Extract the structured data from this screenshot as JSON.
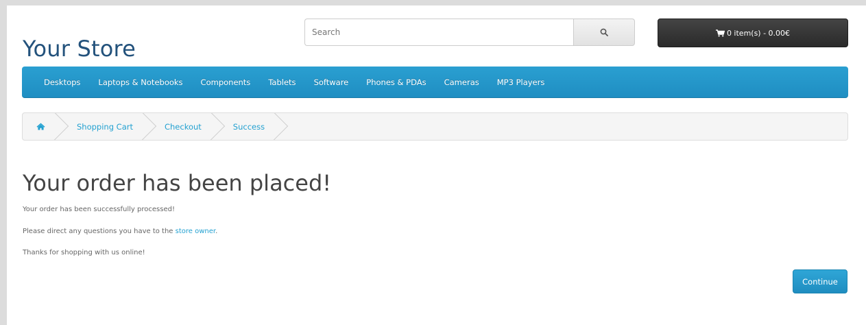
{
  "header": {
    "logo_text": "Your Store",
    "search_placeholder": "Search",
    "cart_label": "0 item(s) - 0.00€"
  },
  "nav": {
    "items": [
      "Desktops",
      "Laptops & Notebooks",
      "Components",
      "Tablets",
      "Software",
      "Phones & PDAs",
      "Cameras",
      "MP3 Players"
    ]
  },
  "breadcrumb": {
    "home_icon": "home-icon",
    "items": [
      "Shopping Cart",
      "Checkout",
      "Success"
    ]
  },
  "content": {
    "title": "Your order has been placed!",
    "line1": "Your order has been successfully processed!",
    "line2_prefix": "Please direct any questions you have to the ",
    "line2_link": "store owner",
    "line2_suffix": ".",
    "line3": "Thanks for shopping with us online!",
    "continue_label": "Continue"
  },
  "colors": {
    "nav_bg": "#229ac8",
    "link": "#23a1d1",
    "logo": "#23527c",
    "cart_bg": "#363636"
  }
}
